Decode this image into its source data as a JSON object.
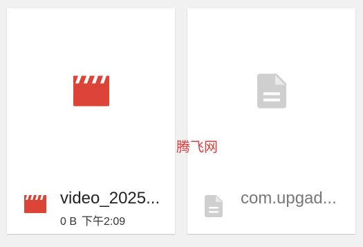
{
  "files": [
    {
      "name": "video_2025...",
      "size": "0 B",
      "time": "下午2:09",
      "icon": "clapperboard-icon",
      "icon_color": "#db4437"
    },
    {
      "name": "com.upgad...",
      "icon": "document-icon",
      "icon_color": "#cfcfcf"
    }
  ],
  "watermark": "腾飞网",
  "colors": {
    "background": "#f1f1f1",
    "card": "#ffffff",
    "video_red": "#db4437",
    "doc_gray": "#cfcfcf"
  }
}
